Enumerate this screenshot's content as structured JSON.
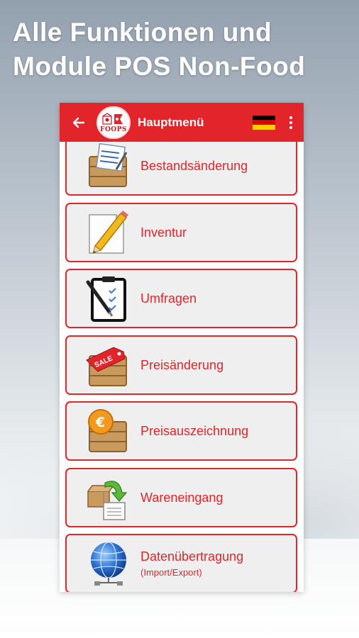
{
  "promo": {
    "line1": "Alle Funktionen und",
    "line2": "Module POS Non-Food"
  },
  "appbar": {
    "title": "Hauptmenü",
    "logo_text": "FOOPS",
    "back_icon": "arrow-left-icon",
    "flag": "germany-flag-icon",
    "overflow_icon": "more-vert-icon"
  },
  "colors": {
    "accent": "#e2252a",
    "item_bg": "#efefef"
  },
  "menu": [
    {
      "label": "Bestandsänderung",
      "icon": "crate-document-icon"
    },
    {
      "label": "Inventur",
      "icon": "paper-pencil-icon"
    },
    {
      "label": "Umfragen",
      "icon": "clipboard-checklist-icon"
    },
    {
      "label": "Preisänderung",
      "icon": "crate-sale-tag-icon"
    },
    {
      "label": "Preisauszeichnung",
      "icon": "crate-euro-icon"
    },
    {
      "label": "Wareneingang",
      "icon": "box-arrow-document-icon"
    },
    {
      "label": "Datenübertragung",
      "sublabel": "(Import/Export)",
      "icon": "globe-network-icon"
    }
  ]
}
